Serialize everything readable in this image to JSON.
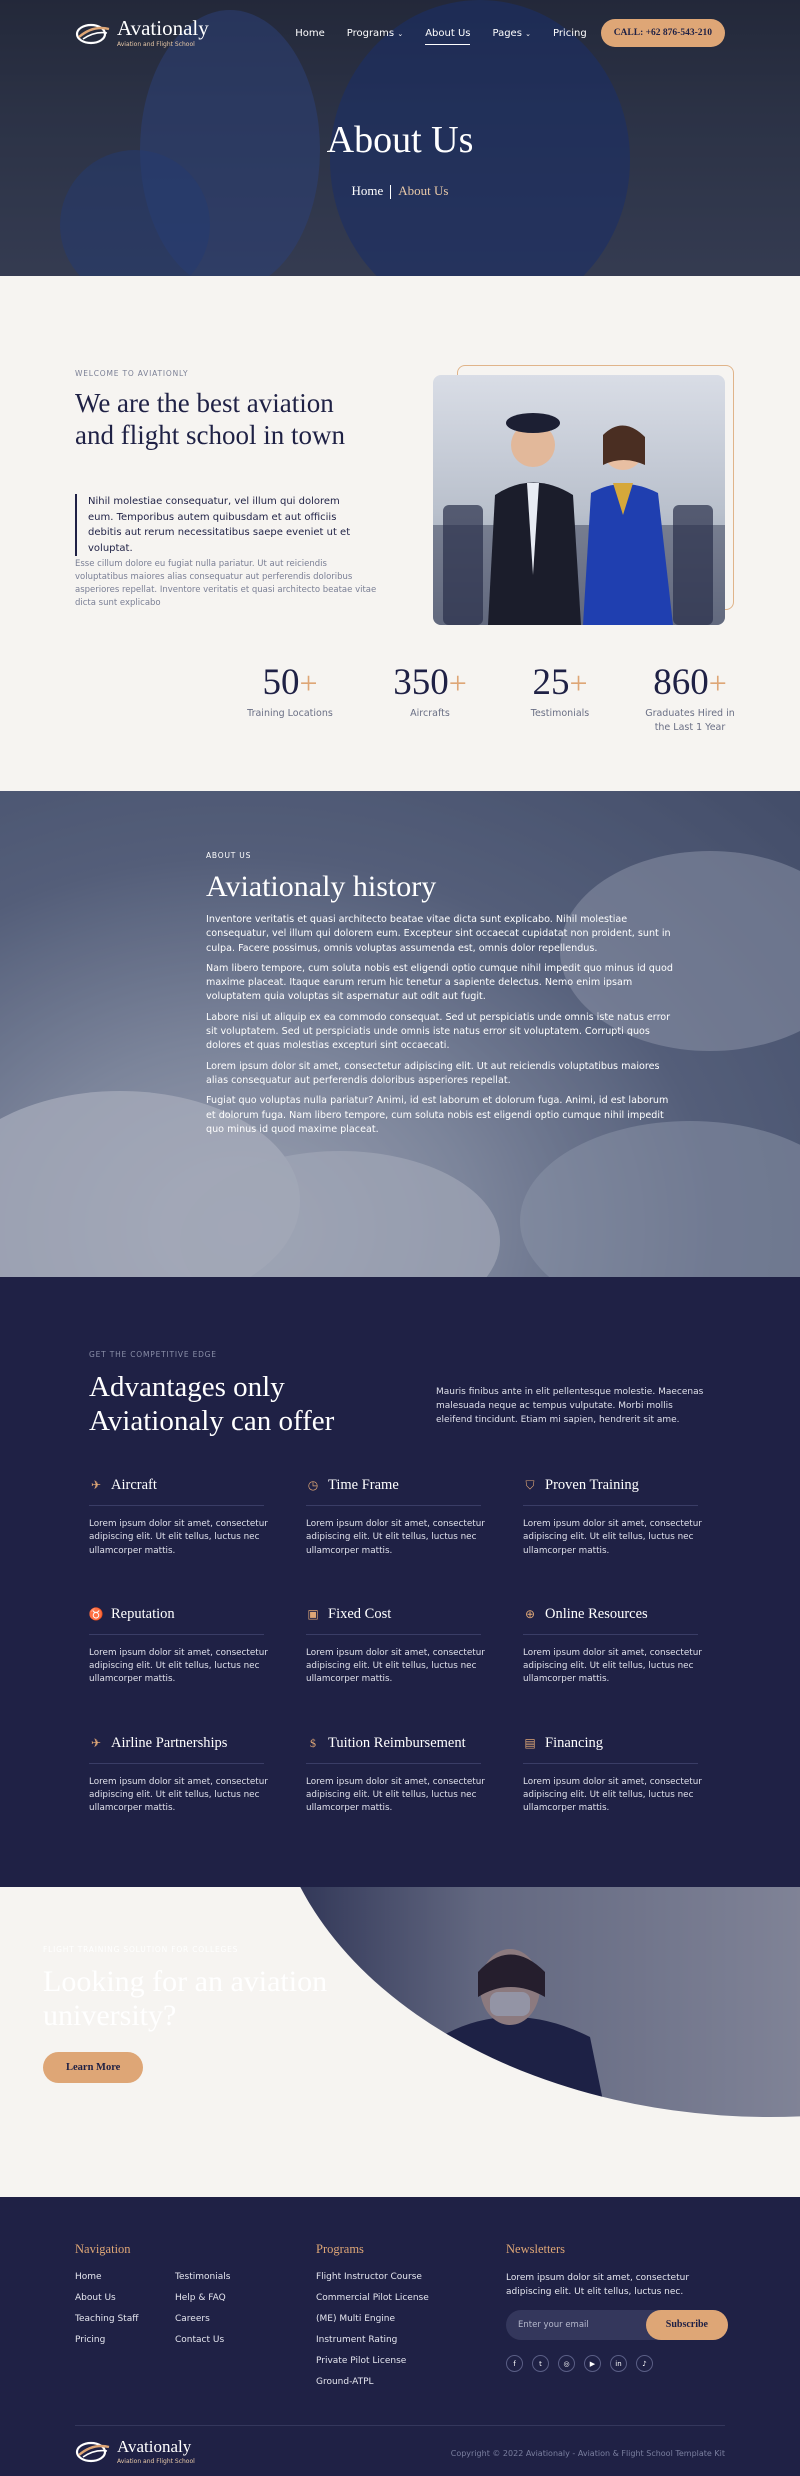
{
  "nav": {
    "logo_name": "Avationaly",
    "logo_tagline": "Aviation and Flight School",
    "items": [
      {
        "label": "Home"
      },
      {
        "label": "Programs"
      },
      {
        "label": "About Us"
      },
      {
        "label": "Pages"
      },
      {
        "label": "Pricing"
      }
    ],
    "call_button": "CALL: +62 876-543-210"
  },
  "hero": {
    "title": "About Us",
    "crumb_home": "Home",
    "crumb_current": "About Us"
  },
  "about": {
    "eyebrow": "WELCOME TO AVIATIONLY",
    "title": "We are the best aviation and flight school in town",
    "quote": "Nihil molestiae consequatur, vel illum qui dolorem eum. Temporibus autem quibusdam et aut officiis debitis aut rerum necessitatibus saepe eveniet ut et voluptat.",
    "body": "Esse cillum dolore eu fugiat nulla pariatur. Ut aut reiciendis voluptatibus maiores alias consequatur aut perferendis doloribus asperiores repellat. Inventore veritatis et quasi architecto beatae vitae dicta sunt explicabo",
    "stats": [
      {
        "num": "50",
        "label": "Training Locations"
      },
      {
        "num": "350",
        "label": "Aircrafts"
      },
      {
        "num": "25",
        "label": "Testimonials"
      },
      {
        "num": "860",
        "label": "Graduates Hired in the Last 1 Year"
      }
    ]
  },
  "history": {
    "eyebrow": "ABOUT US",
    "title": "Aviationaly history",
    "paragraphs": [
      "Inventore veritatis et quasi architecto beatae vitae dicta sunt explicabo. Nihil molestiae consequatur, vel illum qui dolorem eum. Excepteur sint occaecat cupidatat non proident, sunt in culpa. Facere possimus, omnis voluptas assumenda est, omnis dolor repellendus.",
      "Nam libero tempore, cum soluta nobis est eligendi optio cumque nihil impedit quo minus id quod maxime placeat. Itaque earum rerum hic tenetur a sapiente delectus. Nemo enim ipsam voluptatem quia voluptas sit aspernatur aut odit aut fugit.",
      "Labore nisi ut aliquip ex ea commodo consequat. Sed ut perspiciatis unde omnis iste natus error sit voluptatem. Sed ut perspiciatis unde omnis iste natus error sit voluptatem. Corrupti quos dolores et quas molestias excepturi sint occaecati.",
      "Lorem ipsum dolor sit amet, consectetur adipiscing elit. Ut aut reiciendis voluptatibus maiores alias consequatur aut perferendis doloribus asperiores repellat.",
      "Fugiat quo voluptas nulla pariatur? Animi, id est laborum et dolorum fuga. Animi, id est laborum et dolorum fuga. Nam libero tempore, cum soluta nobis est eligendi optio cumque nihil impedit quo minus id quod maxime placeat."
    ]
  },
  "advantages": {
    "eyebrow": "GET THE COMPETITIVE EDGE",
    "title": "Advantages only Aviationaly can offer",
    "intro": "Mauris finibus ante in elit pellentesque molestie. Maecenas malesuada neque ac tempus vulputate. Morbi mollis eleifend tincidunt. Etiam mi sapien, hendrerit sit ame.",
    "items": [
      {
        "title": "Aircraft",
        "icon": "plane-icon",
        "text": "Lorem ipsum dolor sit amet, consectetur adipiscing elit. Ut elit tellus, luctus nec ullamcorper mattis."
      },
      {
        "title": "Time Frame",
        "icon": "clock-icon",
        "text": "Lorem ipsum dolor sit amet, consectetur adipiscing elit. Ut elit tellus, luctus nec ullamcorper mattis."
      },
      {
        "title": "Proven Training",
        "icon": "shield-icon",
        "text": "Lorem ipsum dolor sit amet, consectetur adipiscing elit. Ut elit tellus, luctus nec ullamcorper mattis."
      },
      {
        "title": "Reputation",
        "icon": "medal-icon",
        "text": "Lorem ipsum dolor sit amet, consectetur adipiscing elit. Ut elit tellus, luctus nec ullamcorper mattis."
      },
      {
        "title": "Fixed Cost",
        "icon": "money-icon",
        "text": "Lorem ipsum dolor sit amet, consectetur adipiscing elit. Ut elit tellus, luctus nec ullamcorper mattis."
      },
      {
        "title": "Online Resources",
        "icon": "globe-icon",
        "text": "Lorem ipsum dolor sit amet, consectetur adipiscing elit. Ut elit tellus, luctus nec ullamcorper mattis."
      },
      {
        "title": "Airline Partnerships",
        "icon": "plane-takeoff-icon",
        "text": "Lorem ipsum dolor sit amet, consectetur adipiscing elit. Ut elit tellus, luctus nec ullamcorper mattis."
      },
      {
        "title": "Tuition Reimbursement",
        "icon": "dollar-icon",
        "text": "Lorem ipsum dolor sit amet, consectetur adipiscing elit. Ut elit tellus, luctus nec ullamcorper mattis."
      },
      {
        "title": "Financing",
        "icon": "invoice-icon",
        "text": "Lorem ipsum dolor sit amet, consectetur adipiscing elit. Ut elit tellus, luctus nec ullamcorper mattis."
      }
    ]
  },
  "cta": {
    "eyebrow": "FLIGHT TRAINING SOLUTION FOR COLLEGES",
    "title": "Looking for an aviation university?",
    "button": "Learn More"
  },
  "footer": {
    "nav_title": "Navigation",
    "nav_links": [
      "Home",
      "Testimonials",
      "About Us",
      "Help & FAQ",
      "Teaching Staff",
      "Careers",
      "Pricing",
      "Contact Us"
    ],
    "programs_title": "Programs",
    "program_links": [
      "Flight Instructor Course",
      "Commercial Pilot License",
      "(ME) Multi Engine",
      "Instrument Rating",
      "Private Pilot License",
      "Ground-ATPL"
    ],
    "news_title": "Newsletters",
    "news_text": "Lorem ipsum dolor sit amet, consectetur adipiscing elit. Ut elit tellus, luctus nec.",
    "email_placeholder": "Enter your email",
    "subscribe": "Subscribe",
    "social": [
      "facebook-icon",
      "twitter-icon",
      "instagram-icon",
      "youtube-icon",
      "linkedin-icon",
      "tiktok-icon"
    ],
    "copyright": "Copyright © 2022 Aviationaly - Aviation & Flight School Template Kit"
  },
  "colors": {
    "navy": "#1f2145",
    "accent": "#dea676"
  }
}
